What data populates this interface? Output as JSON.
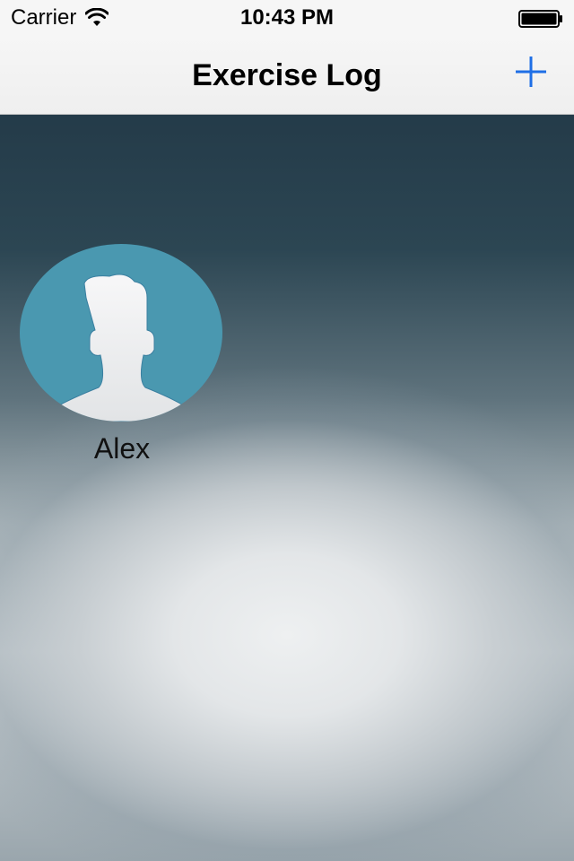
{
  "status_bar": {
    "carrier": "Carrier",
    "time": "10:43 PM"
  },
  "nav": {
    "title": "Exercise Log",
    "add_icon": "plus-icon",
    "accent_color": "#1f6fe6"
  },
  "users": [
    {
      "name": "Alex",
      "avatar_icon": "person-silhouette-icon",
      "avatar_color": "#4a98b0"
    }
  ]
}
